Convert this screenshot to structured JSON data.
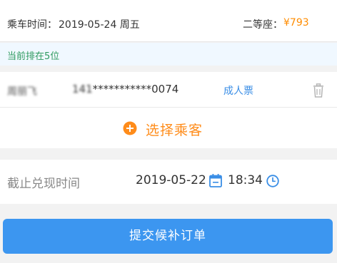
{
  "trip": {
    "label": "乘车时间：",
    "date": "2019-05-24 周五",
    "seat_label": "二等座：",
    "price": "¥793"
  },
  "queue": {
    "text": "当前排在5位"
  },
  "passenger": {
    "name": "周丽飞",
    "id_prefix": "141",
    "id_masked": "***********0074",
    "ticket_type": "成人票"
  },
  "select_passenger": {
    "label": "选择乘客"
  },
  "deadline": {
    "label": "截止兑现时间",
    "date": "2019-05-22",
    "time": "18:34"
  },
  "submit": {
    "label": "提交候补订单"
  },
  "colors": {
    "price": "#ff8c00",
    "queue_text": "#2e9a5e",
    "accent_blue": "#3a8ee6",
    "select_orange": "#ff8c1a",
    "button_blue": "#3c96f0"
  },
  "icons": [
    "trash-icon",
    "plus-circle-icon",
    "calendar-icon",
    "clock-icon"
  ]
}
